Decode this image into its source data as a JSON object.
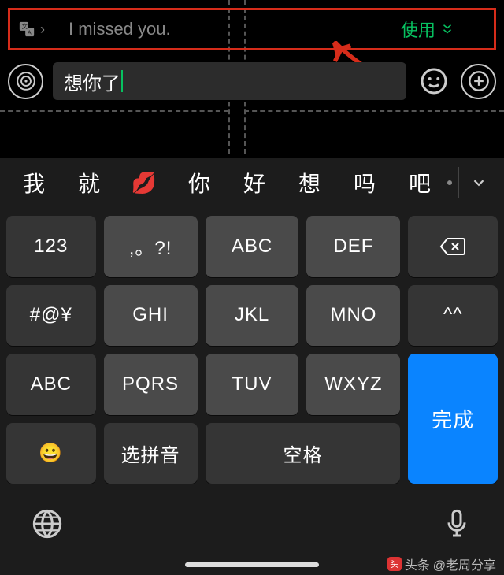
{
  "translate": {
    "source_text": "I missed you.",
    "apply_label": "使用"
  },
  "input": {
    "value": "想你了"
  },
  "candidates": [
    "我",
    "就",
    "💋",
    "你",
    "好",
    "想",
    "吗",
    "吧"
  ],
  "keyboard": {
    "rows": [
      [
        "123",
        ",。?!",
        "ABC",
        "DEF",
        "⌫"
      ],
      [
        "#@¥",
        "GHI",
        "JKL",
        "MNO",
        "^^"
      ],
      [
        "ABC",
        "PQRS",
        "TUV",
        "WXYZ",
        ""
      ],
      [
        "😀",
        "选拼音",
        "空格",
        "",
        "完成"
      ]
    ],
    "num_key": "123",
    "punct_key": ",。?!",
    "abc_key": "ABC",
    "def_key": "DEF",
    "sym_key": "#@¥",
    "ghi_key": "GHI",
    "jkl_key": "JKL",
    "mno_key": "MNO",
    "caps_key": "^^",
    "alpha_key": "ABC",
    "pqrs_key": "PQRS",
    "tuv_key": "TUV",
    "wxyz_key": "WXYZ",
    "emoji_key": "😀",
    "pinyin_key": "选拼音",
    "space_key": "空格",
    "done_key": "完成"
  },
  "watermark": {
    "brand": "头条",
    "author": "@老周分享"
  }
}
